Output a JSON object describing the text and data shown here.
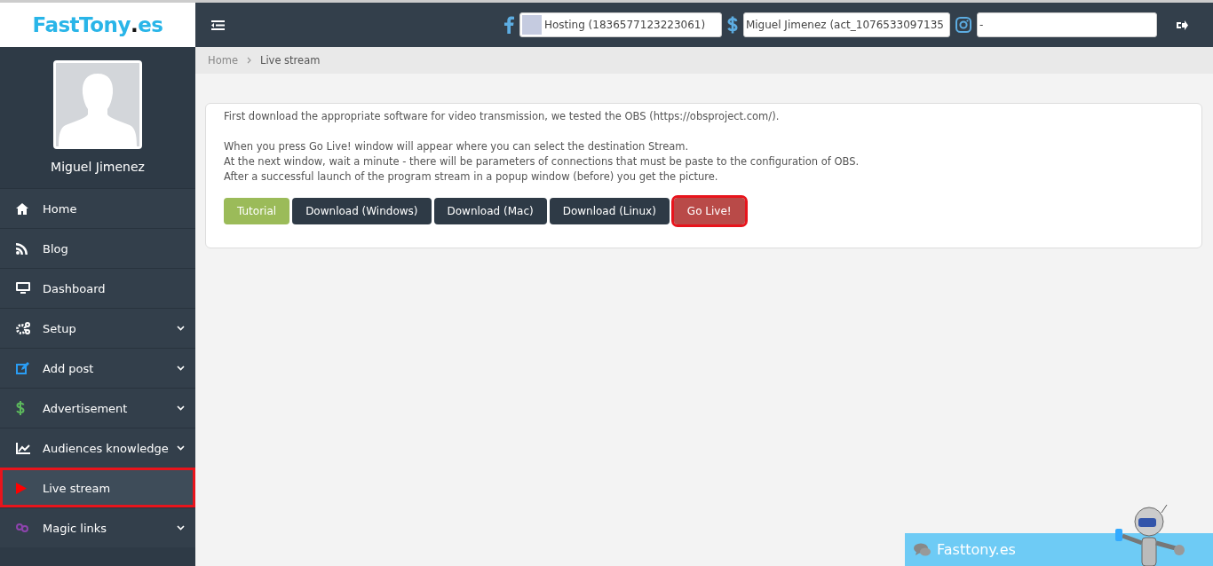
{
  "logo": {
    "name": "FastTony",
    "dot": ".",
    "tld": "es"
  },
  "profile": {
    "name": "Miguel Jimenez"
  },
  "nav": [
    {
      "label": "Home",
      "expandable": false,
      "selected": false,
      "highlighted": false
    },
    {
      "label": "Blog",
      "expandable": false,
      "selected": false,
      "highlighted": false
    },
    {
      "label": "Dashboard",
      "expandable": false,
      "selected": false,
      "highlighted": false
    },
    {
      "label": "Setup",
      "expandable": true,
      "selected": false,
      "highlighted": false
    },
    {
      "label": "Add post",
      "expandable": true,
      "selected": false,
      "highlighted": false
    },
    {
      "label": "Advertisement",
      "expandable": true,
      "selected": false,
      "highlighted": false
    },
    {
      "label": "Audiences knowledge",
      "expandable": true,
      "selected": false,
      "highlighted": false
    },
    {
      "label": "Live stream",
      "expandable": false,
      "selected": true,
      "highlighted": true
    },
    {
      "label": "Magic links",
      "expandable": true,
      "selected": false,
      "highlighted": false
    }
  ],
  "header": {
    "selects": [
      {
        "value": "Hosting (1836577123223061)"
      },
      {
        "value": "Miguel Jimenez (act_1076533097135"
      },
      {
        "value": "-"
      }
    ]
  },
  "breadcrumb": [
    "Home",
    "Live stream"
  ],
  "instructions": {
    "intro": "First download the appropriate software for video transmission, we tested the OBS (https://obsproject.com/).",
    "steps": [
      "When you press Go Live! window will appear where you can select the destination Stream.",
      "At the next window, wait a minute - there will be parameters of connections that must be paste to the configuration of OBS.",
      "After a successful launch of the program stream in a popup window (before) you get the picture."
    ]
  },
  "buttons": [
    {
      "label": "Tutorial",
      "kind": "tutorial",
      "highlighted": false
    },
    {
      "label": "Download (Windows)",
      "kind": "download",
      "highlighted": false
    },
    {
      "label": "Download (Mac)",
      "kind": "download",
      "highlighted": false
    },
    {
      "label": "Download (Linux)",
      "kind": "download",
      "highlighted": false
    },
    {
      "label": "Go Live!",
      "kind": "live",
      "highlighted": true
    }
  ],
  "chat": {
    "title": "Fasttony.es"
  }
}
